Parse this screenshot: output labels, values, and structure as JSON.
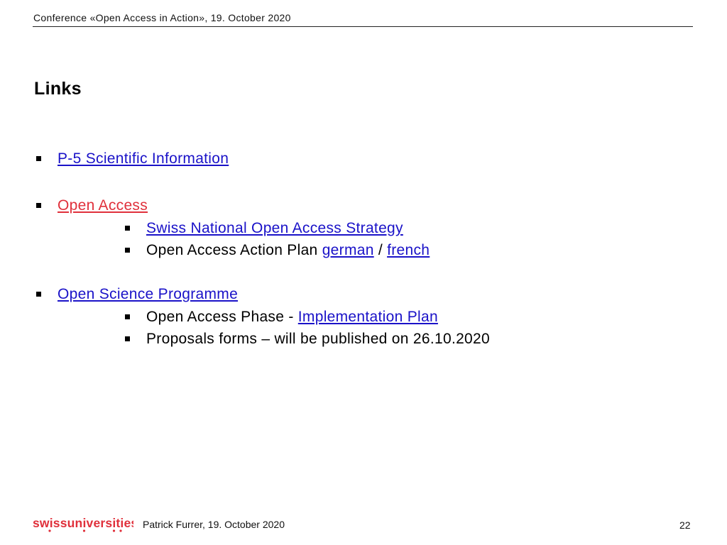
{
  "header": {
    "title": "Conference «Open Access in Action», 19. October 2020"
  },
  "page_title": "Links",
  "items": {
    "p5": {
      "label": "P-5 Scientific Information"
    },
    "open_access": {
      "label": "Open Access",
      "strategy": "Swiss National Open Access Strategy",
      "action_plan_text": "Open Access Action Plan ",
      "german": "german",
      "separator": " / ",
      "french": "french"
    },
    "open_science": {
      "label": "Open Science Programme",
      "phase_text": "Open Access Phase - ",
      "implementation": "Implementation Plan",
      "proposals": "Proposals forms – will be published on 26.10.2020"
    }
  },
  "colors": {
    "link": "#1a12c8",
    "visited_link": "#e0303b",
    "brand": "#e0303b"
  },
  "footer": {
    "logo": "swissuniversities",
    "author": "Patrick Furrer, 19. October 2020",
    "page_number": "22"
  }
}
